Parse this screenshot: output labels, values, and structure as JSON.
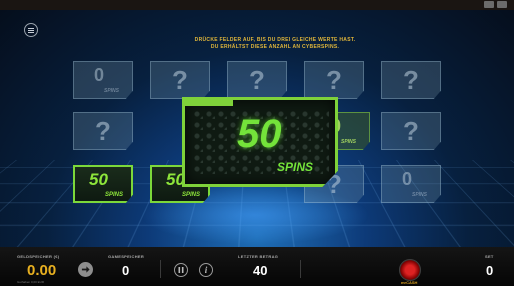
{
  "instruction": {
    "line1": "DRÜCKE FELDER AUF, BIS DU DREI GLEICHE WERTE HAST.",
    "line2": "DU ERHÄLTST DIESE ANZAHL AN CYBERSPINS."
  },
  "grid": {
    "question_mark": "?",
    "revealed_zero_value": "0",
    "revealed_zero_label": "SPINS",
    "zero_right_value": "0",
    "zero_right_label": "SPINS",
    "dim_green_value": "0",
    "dim_green_label": "SPINS"
  },
  "won_tiles": [
    {
      "value": "50",
      "label": "SPINS"
    },
    {
      "value": "50",
      "label": "SPINS"
    }
  ],
  "big_win": {
    "value": "50",
    "label": "SPINS"
  },
  "bottom_bar": {
    "balance_label": "GELDSPEICHER (€)",
    "balance_value": "0.00",
    "balance_note": "Guthaben 0,00 EUR",
    "bonus_label": "GAMESPEICHER",
    "bonus_value": "0",
    "last_win_label": "LETZTER BETRAG",
    "last_win_value": "40",
    "bet_label": "SET",
    "bet_value": "0",
    "logo_text": "mrCASH"
  },
  "colors": {
    "accent_green": "#7fd23a",
    "instruction_gold": "#e0b63a",
    "balance_gold": "#e8b020"
  },
  "icons": [
    "menu-icon",
    "arrow-right-icon",
    "pause-icon",
    "info-icon",
    "gem-logo-icon"
  ]
}
